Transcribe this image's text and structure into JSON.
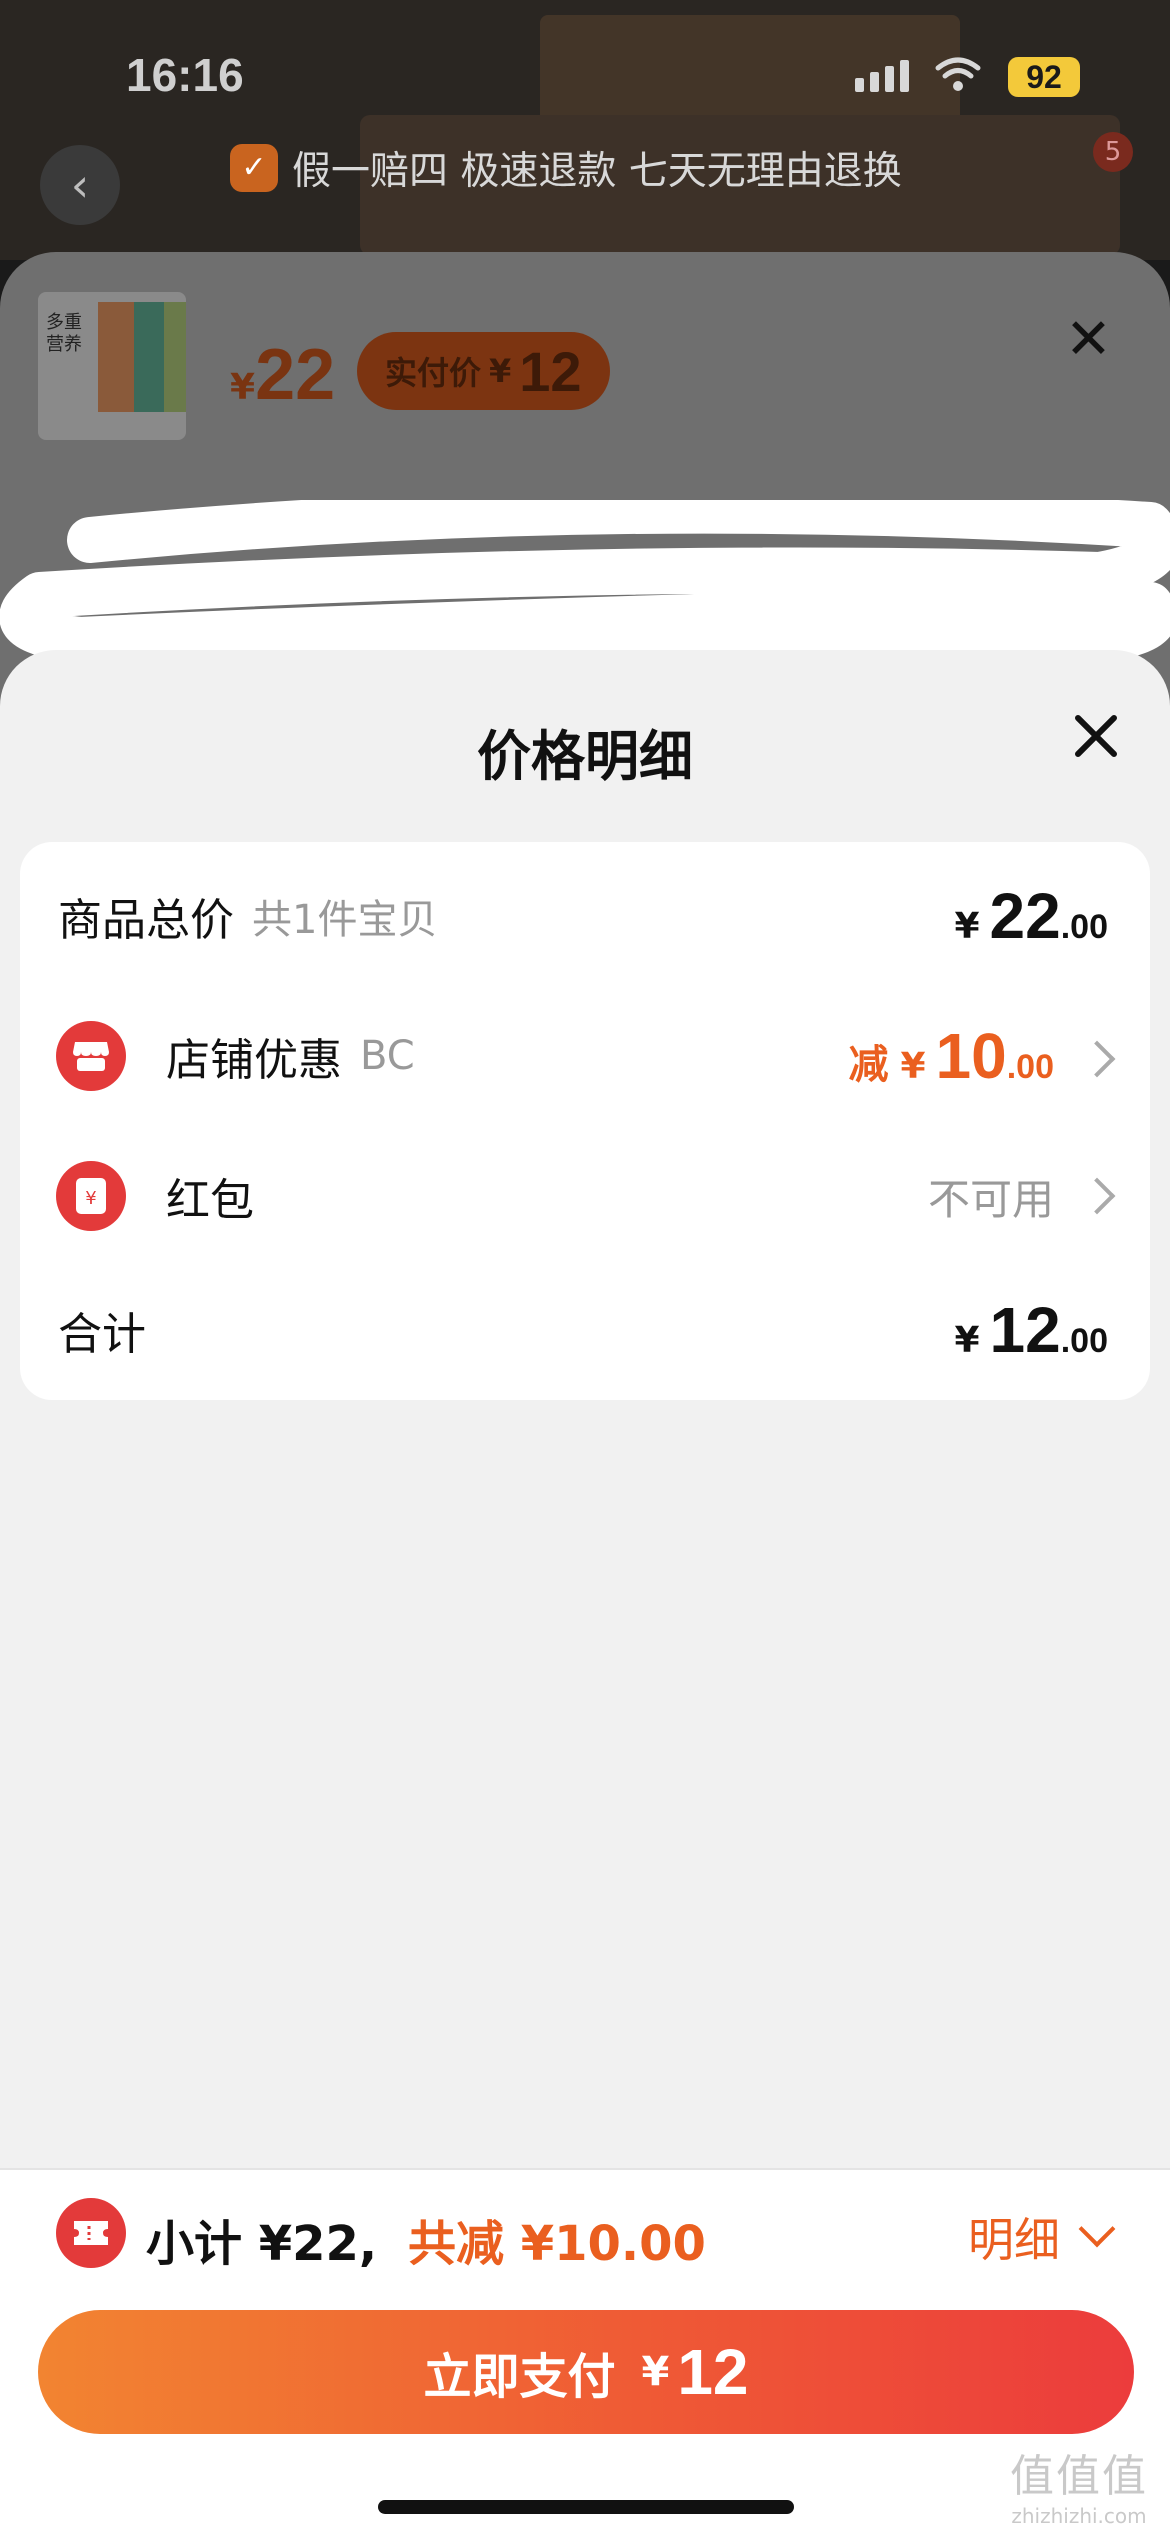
{
  "status_bar": {
    "time": "16:16",
    "battery": "92"
  },
  "header": {
    "guarantee_text": "假一赔四 极速退款 七天无理由退换",
    "cart_badge": "5"
  },
  "product_sheet": {
    "thumbnail_text": "多重营养",
    "price_symbol": "¥",
    "price": "22",
    "actual_price_label": "实付价",
    "actual_price_symbol": "¥",
    "actual_price": "12"
  },
  "price_detail": {
    "title": "价格明细",
    "rows": [
      {
        "label": "商品总价",
        "sub": "共1件宝贝",
        "symbol": "¥",
        "integer": "22",
        "decimal": ".00"
      },
      {
        "label": "店铺优惠",
        "sub": "BC",
        "prefix": "减",
        "symbol": "¥",
        "integer": "10",
        "decimal": ".00"
      },
      {
        "label": "红包",
        "value_text": "不可用"
      },
      {
        "label": "合计",
        "symbol": "¥",
        "integer": "12",
        "decimal": ".00"
      }
    ]
  },
  "bottom_bar": {
    "subtotal_text": "小计 ¥22,",
    "saved_text": "共减 ¥10.00",
    "detail_label": "明细",
    "pay_label": "立即支付",
    "pay_symbol": "¥",
    "pay_amount": "12"
  },
  "watermark": {
    "line1": "值值值",
    "line2": "zhizhizhi.com"
  },
  "colors": {
    "accent": "#ea5f1f",
    "icon_red": "#e33a3a",
    "sheet_bg": "#f1f1f1"
  }
}
